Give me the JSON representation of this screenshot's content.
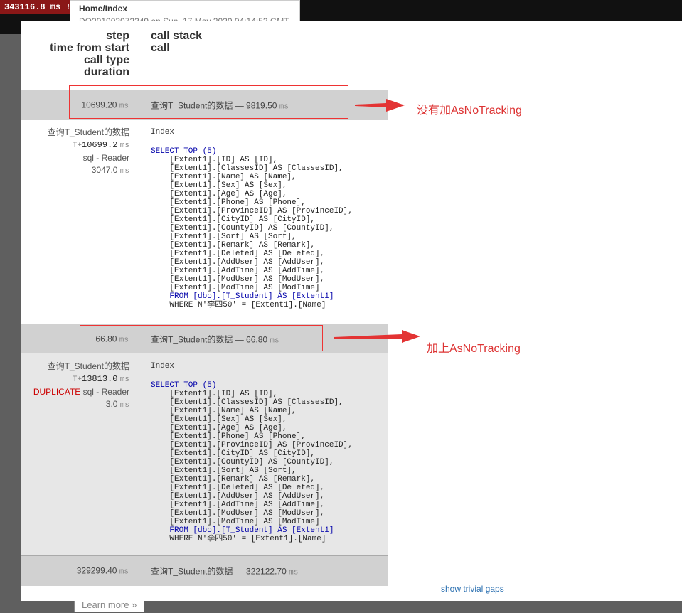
{
  "header_bar": {
    "timing_badge": "343116.8 ms !",
    "route": "Home/Index",
    "route_subtitle": "DO201903072349 on Sun, 17 May 2020 04:14:53 GMT"
  },
  "learn_more": "Learn more »",
  "columns": {
    "left": [
      "step",
      "time from start",
      "call type",
      "duration"
    ],
    "right": [
      "call stack",
      "call"
    ]
  },
  "ms": "ms",
  "steps": [
    {
      "duration": "10699.20",
      "label": "查询T_Student的数据 — 9819.50",
      "call": {
        "name": "查询T_Student的数据",
        "time_prefix": "T+",
        "time": "10699.2",
        "duplicate": "",
        "type": "sql - Reader",
        "duration": "3047.0",
        "stack": "Index",
        "sql_head": "SELECT TOP (5)",
        "sql_body": [
          "    [Extent1].[ID] AS [ID],",
          "    [Extent1].[ClassesID] AS [ClassesID],",
          "    [Extent1].[Name] AS [Name],",
          "    [Extent1].[Sex] AS [Sex],",
          "    [Extent1].[Age] AS [Age],",
          "    [Extent1].[Phone] AS [Phone],",
          "    [Extent1].[ProvinceID] AS [ProvinceID],",
          "    [Extent1].[CityID] AS [CityID],",
          "    [Extent1].[CountyID] AS [CountyID],",
          "    [Extent1].[Sort] AS [Sort],",
          "    [Extent1].[Remark] AS [Remark],",
          "    [Extent1].[Deleted] AS [Deleted],",
          "    [Extent1].[AddUser] AS [AddUser],",
          "    [Extent1].[AddTime] AS [AddTime],",
          "    [Extent1].[ModUser] AS [ModUser],",
          "    [Extent1].[ModTime] AS [ModTime]"
        ],
        "sql_from": "    FROM [dbo].[T_Student] AS [Extent1]",
        "sql_where": "    WHERE N'李四50' = [Extent1].[Name]"
      }
    },
    {
      "duration": "66.80",
      "label": "查询T_Student的数据 — 66.80",
      "call": {
        "name": "查询T_Student的数据",
        "time_prefix": "T+",
        "time": "13813.0",
        "duplicate": "DUPLICATE",
        "type": " sql - Reader",
        "duration": "3.0",
        "stack": "Index",
        "sql_head": "SELECT TOP (5)",
        "sql_body": [
          "    [Extent1].[ID] AS [ID],",
          "    [Extent1].[ClassesID] AS [ClassesID],",
          "    [Extent1].[Name] AS [Name],",
          "    [Extent1].[Sex] AS [Sex],",
          "    [Extent1].[Age] AS [Age],",
          "    [Extent1].[Phone] AS [Phone],",
          "    [Extent1].[ProvinceID] AS [ProvinceID],",
          "    [Extent1].[CityID] AS [CityID],",
          "    [Extent1].[CountyID] AS [CountyID],",
          "    [Extent1].[Sort] AS [Sort],",
          "    [Extent1].[Remark] AS [Remark],",
          "    [Extent1].[Deleted] AS [Deleted],",
          "    [Extent1].[AddUser] AS [AddUser],",
          "    [Extent1].[AddTime] AS [AddTime],",
          "    [Extent1].[ModUser] AS [ModUser],",
          "    [Extent1].[ModTime] AS [ModTime]"
        ],
        "sql_from": "    FROM [dbo].[T_Student] AS [Extent1]",
        "sql_where": "    WHERE N'李四50' = [Extent1].[Name]"
      }
    },
    {
      "duration": "329299.40",
      "label": "查询T_Student的数据 — 322122.70"
    }
  ],
  "annotations": {
    "first": "没有加AsNoTracking",
    "second": "加上AsNoTracking",
    "color": "#e33333"
  },
  "show_trivial": "show trivial gaps"
}
